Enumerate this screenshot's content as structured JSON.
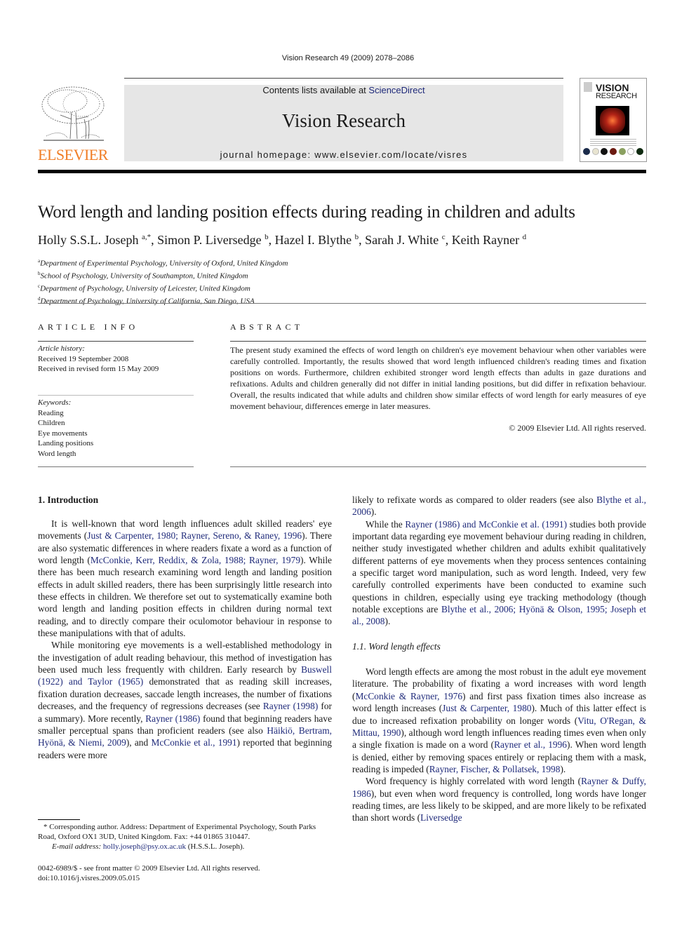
{
  "running_header": "Vision Research 49 (2009) 2078–2086",
  "masthead": {
    "publisher_logo_text": "ELSEVIER",
    "contents_prefix": "Contents lists available at ",
    "contents_link": "ScienceDirect",
    "journal_name": "Vision Research",
    "homepage": "journal homepage: www.elsevier.com/locate/visres",
    "cover_title_line1": "VISION",
    "cover_title_line2": "RESEARCH",
    "colors": {
      "elsevier_orange": "#f07e26",
      "link_blue": "#1f2a7a",
      "banner_gray": "#e6e6e6"
    }
  },
  "article": {
    "title": "Word length and landing position effects during reading in children and adults",
    "authors": [
      {
        "name": "Holly S.S.L. Joseph",
        "sup": "a,*"
      },
      {
        "name": "Simon P. Liversedge",
        "sup": "b"
      },
      {
        "name": "Hazel I. Blythe",
        "sup": "b"
      },
      {
        "name": "Sarah J. White",
        "sup": "c"
      },
      {
        "name": "Keith Rayner",
        "sup": "d"
      }
    ],
    "affiliations": [
      {
        "sup": "a",
        "text": "Department of Experimental Psychology, University of Oxford, United Kingdom"
      },
      {
        "sup": "b",
        "text": "School of Psychology, University of Southampton, United Kingdom"
      },
      {
        "sup": "c",
        "text": "Department of Psychology, University of Leicester, United Kingdom"
      },
      {
        "sup": "d",
        "text": "Department of Psychology, University of California, San Diego, USA"
      }
    ]
  },
  "article_info": {
    "heading": "ARTICLE INFO",
    "history_label": "Article history:",
    "received": "Received 19 September 2008",
    "revised": "Received in revised form 15 May 2009",
    "keywords_label": "Keywords:",
    "keywords": [
      "Reading",
      "Children",
      "Eye movements",
      "Landing positions",
      "Word length"
    ]
  },
  "abstract": {
    "heading": "ABSTRACT",
    "text": "The present study examined the effects of word length on children's eye movement behaviour when other variables were carefully controlled. Importantly, the results showed that word length influenced children's reading times and fixation positions on words. Furthermore, children exhibited stronger word length effects than adults in gaze durations and refixations. Adults and children generally did not differ in initial landing positions, but did differ in refixation behaviour. Overall, the results indicated that while adults and children show similar effects of word length for early measures of eye movement behaviour, differences emerge in later measures.",
    "copyright": "© 2009 Elsevier Ltd. All rights reserved."
  },
  "body": {
    "section1_heading": "1. Introduction",
    "left_paragraphs": [
      [
        {
          "t": "It is well-known that word length influences adult skilled readers' eye movements ("
        },
        {
          "c": "Just & Carpenter, 1980; Rayner, Sereno, & Raney, 1996"
        },
        {
          "t": "). There are also systematic differences in where readers fixate a word as a function of word length ("
        },
        {
          "c": "McConkie, Kerr, Reddix, & Zola, 1988; Rayner, 1979"
        },
        {
          "t": "). While there has been much research examining word length and landing position effects in adult skilled readers, there has been surprisingly little research into these effects in children. We therefore set out to systematically examine both word length and landing position effects in children during normal text reading, and to directly compare their oculomotor behaviour in response to these manipulations with that of adults."
        }
      ],
      [
        {
          "t": "While monitoring eye movements is a well-established methodology in the investigation of adult reading behaviour, this method of investigation has been used much less frequently with children. Early research by "
        },
        {
          "c": "Buswell (1922) and Taylor (1965)"
        },
        {
          "t": " demonstrated that as reading skill increases, fixation duration decreases, saccade length increases, the number of fixations decreases, and the frequency of regressions decreases (see "
        },
        {
          "c": "Rayner (1998)"
        },
        {
          "t": " for a summary). More recently, "
        },
        {
          "c": "Rayner (1986)"
        },
        {
          "t": " found that beginning readers have smaller perceptual spans than proficient readers (see also "
        },
        {
          "c": "Häikiö, Bertram, Hyönä, & Niemi, 2009"
        },
        {
          "t": "), and "
        },
        {
          "c": "McConkie et al., 1991"
        },
        {
          "t": ") reported that beginning readers were more"
        }
      ]
    ],
    "right_continuation": [
      {
        "t": "likely to refixate words as compared to older readers (see also "
      },
      {
        "c": "Blythe et al., 2006"
      },
      {
        "t": ")."
      }
    ],
    "right_paragraph2": [
      {
        "t": "While the "
      },
      {
        "c": "Rayner (1986) and McConkie et al. (1991)"
      },
      {
        "t": " studies both provide important data regarding eye movement behaviour during reading in children, neither study investigated whether children and adults exhibit qualitatively different patterns of eye movements when they process sentences containing a specific target word manipulation, such as word length. Indeed, very few carefully controlled experiments have been conducted to examine such questions in children, especially using eye tracking methodology (though notable exceptions are "
      },
      {
        "c": "Blythe et al., 2006; Hyönä & Olson, 1995; Joseph et al., 2008"
      },
      {
        "t": ")."
      }
    ],
    "subsection_heading": "1.1. Word length effects",
    "right_paragraph3": [
      {
        "t": "Word length effects are among the most robust in the adult eye movement literature. The probability of fixating a word increases with word length ("
      },
      {
        "c": "McConkie & Rayner, 1976"
      },
      {
        "t": ") and first pass fixation times also increase as word length increases ("
      },
      {
        "c": "Just & Carpenter, 1980"
      },
      {
        "t": "). Much of this latter effect is due to increased refixation probability on longer words ("
      },
      {
        "c": "Vitu, O'Regan, & Mittau, 1990"
      },
      {
        "t": "), although word length influences reading times even when only a single fixation is made on a word ("
      },
      {
        "c": "Rayner et al., 1996"
      },
      {
        "t": "). When word length is denied, either by removing spaces entirely or replacing them with a mask, reading is impeded ("
      },
      {
        "c": "Rayner, Fischer, & Pollatsek, 1998"
      },
      {
        "t": ")."
      }
    ],
    "right_paragraph4": [
      {
        "t": "Word frequency is highly correlated with word length ("
      },
      {
        "c": "Rayner & Duffy, 1986"
      },
      {
        "t": "), but even when word frequency is controlled, long words have longer reading times, are less likely to be skipped, and are more likely to be refixated than short words ("
      },
      {
        "c": "Liversedge"
      }
    ]
  },
  "footnote": {
    "corresponding": "* Corresponding author. Address: Department of Experimental Psychology, South Parks Road, Oxford OX1 3UD, United Kingdom. Fax: +44 01865 310447.",
    "email_label": "E-mail address: ",
    "email": "holly.joseph@psy.ox.ac.uk",
    "email_suffix": " (H.S.S.L. Joseph).",
    "issn": "0042-6989/$ - see front matter © 2009 Elsevier Ltd. All rights reserved.",
    "doi": "doi:10.1016/j.visres.2009.05.015"
  }
}
